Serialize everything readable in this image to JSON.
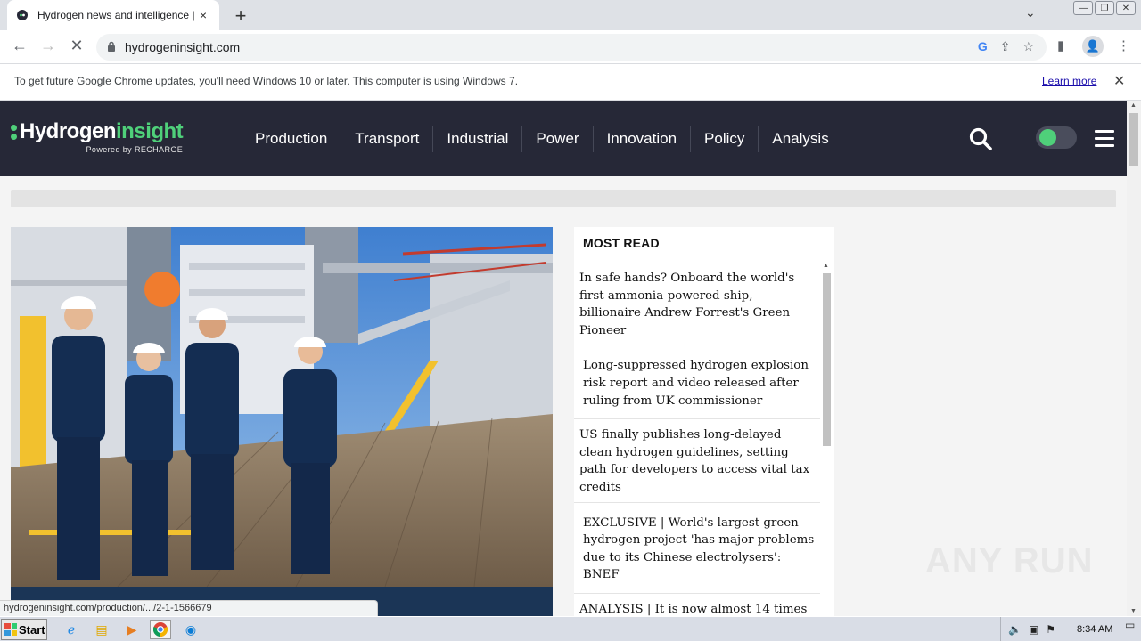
{
  "browser": {
    "tab_title": "Hydrogen news and intelligence | Hy",
    "tab_close": "×",
    "new_tab": "+",
    "tab_menu": "⌄",
    "url": "hydrogeninsight.com",
    "back": "←",
    "forward": "→",
    "reload": "✕"
  },
  "infobar": {
    "message": "To get future Google Chrome updates, you'll need Windows 10 or later. This computer is using Windows 7.",
    "learn_more": "Learn more",
    "close": "✕"
  },
  "site": {
    "logo_main": "Hydrogen",
    "logo_accent": "insight",
    "logo_sub": "Powered by RECHARGE",
    "nav": [
      "Production",
      "Transport",
      "Industrial",
      "Power",
      "Innovation",
      "Policy",
      "Analysis"
    ],
    "accent_color": "#4fd07a",
    "header_color": "#262837"
  },
  "most_read": {
    "heading": "MOST READ",
    "items": [
      "In safe hands? Onboard the world's first ammonia-powered ship, billionaire Andrew Forrest's Green Pioneer",
      "Long-suppressed hydrogen explosion risk report and video released after ruling from UK commissioner",
      "US finally publishes long-delayed clean hydrogen guidelines, setting path for developers to access vital tax credits",
      "EXCLUSIVE | World's largest green hydrogen project 'has major problems due to its Chinese electrolysers': BNEF",
      "ANALYSIS | It is now almost 14 times"
    ]
  },
  "status_url": "hydrogeninsight.com/production/.../2-1-1566679",
  "watermark": "ANY RUN",
  "taskbar": {
    "start": "Start",
    "clock": "8:34 AM"
  }
}
